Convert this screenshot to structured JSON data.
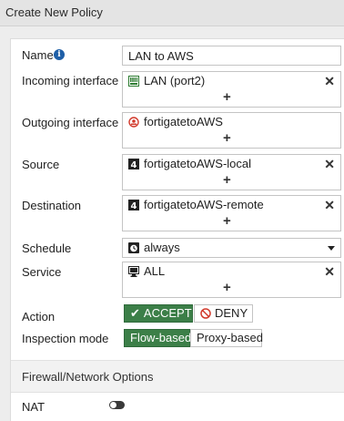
{
  "header": {
    "title": "Create New Policy"
  },
  "form": {
    "name": {
      "label": "Name",
      "value": "LAN to AWS",
      "info_icon": "i"
    },
    "incoming": {
      "label": "Incoming interface",
      "value": "LAN (port2)",
      "icon": "ethernet-port-icon"
    },
    "outgoing": {
      "label": "Outgoing interface",
      "value": "fortigatetoAWS",
      "icon": "vpn-tunnel-icon"
    },
    "source": {
      "label": "Source",
      "value": "fortigatetoAWS-local",
      "icon": "address-icon"
    },
    "destination": {
      "label": "Destination",
      "value": "fortigatetoAWS-remote",
      "icon": "address-icon"
    },
    "schedule": {
      "label": "Schedule",
      "value": "always",
      "icon": "clock-icon"
    },
    "service": {
      "label": "Service",
      "value": "ALL",
      "icon": "service-icon"
    },
    "action": {
      "label": "Action",
      "accept": "ACCEPT",
      "deny": "DENY"
    },
    "inspection": {
      "label": "Inspection mode",
      "flow": "Flow-based",
      "proxy": "Proxy-based"
    }
  },
  "glyphs": {
    "remove": "✕",
    "add": "+",
    "check": "✔"
  },
  "section": {
    "title": "Firewall/Network Options"
  },
  "nat": {
    "label": "NAT",
    "enabled": false
  },
  "colors": {
    "accent_green": "#3c7f48",
    "info_blue": "#1f5fa7",
    "deny_red": "#d23a2c"
  }
}
